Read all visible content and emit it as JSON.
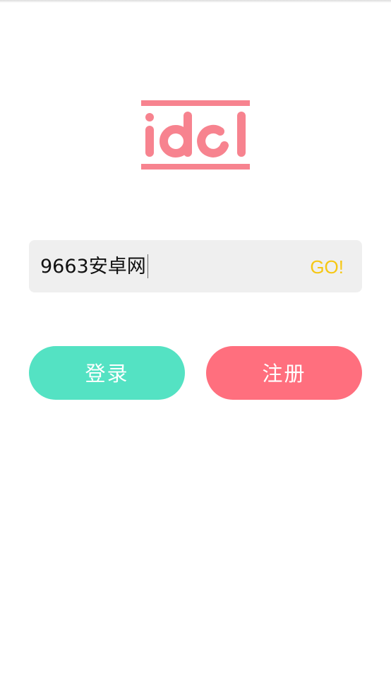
{
  "app": {
    "logo_text": "idol",
    "brand_color": "#f7838f",
    "logo_icon": "idol-logo"
  },
  "search": {
    "value": "9663安卓网",
    "go_label": "GO!",
    "go_color": "#f6c713",
    "field_background": "#efefef"
  },
  "actions": {
    "login_label": "登录",
    "login_color": "#54e2c3",
    "register_label": "注册",
    "register_color": "#ff6f7e"
  }
}
